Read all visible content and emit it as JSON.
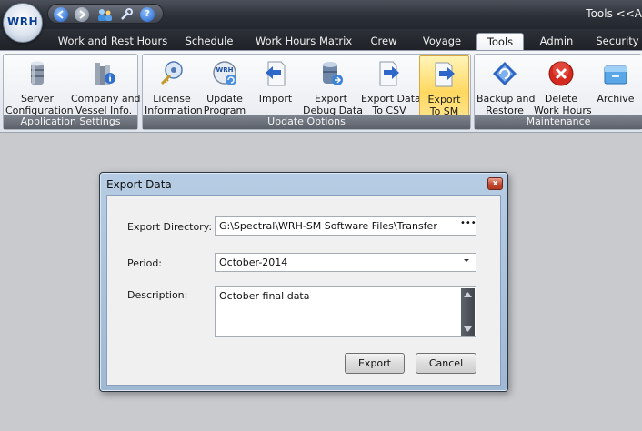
{
  "app": {
    "logo_text": "WRH",
    "window_title": "Tools <<A"
  },
  "quick_access": [
    "back-icon",
    "forward-icon",
    "users-icon",
    "tools-icon",
    "help-icon"
  ],
  "tabs": [
    {
      "label": "Work and Rest Hours"
    },
    {
      "label": "Schedule"
    },
    {
      "label": "Work Hours Matrix"
    },
    {
      "label": "Crew"
    },
    {
      "label": "Voyage"
    },
    {
      "label": "Tools"
    },
    {
      "label": "Admin"
    },
    {
      "label": "Security"
    }
  ],
  "active_tab": "Tools",
  "ribbon": {
    "groups": [
      {
        "label": "Application Settings",
        "buttons": [
          {
            "line1": "Server",
            "line2": "Configuration",
            "icon": "database-icon"
          },
          {
            "line1": "Company and",
            "line2": "Vessel Info.",
            "icon": "building-info-icon"
          }
        ]
      },
      {
        "label": "Update Options",
        "buttons": [
          {
            "line1": "License",
            "line2": "Information",
            "icon": "license-key-icon"
          },
          {
            "line1": "Update",
            "line2": "Program",
            "icon": "update-program-icon"
          },
          {
            "line1": "Import",
            "line2": "",
            "icon": "import-icon"
          },
          {
            "line1": "Export",
            "line2": "Debug Data",
            "icon": "export-debug-icon"
          },
          {
            "line1": "Export Data",
            "line2": "To CSV",
            "icon": "export-csv-icon"
          },
          {
            "line1": "Export",
            "line2": "To SM",
            "icon": "export-sm-icon"
          }
        ]
      },
      {
        "label": "Maintenance",
        "buttons": [
          {
            "line1": "Backup and",
            "line2": "Restore",
            "icon": "backup-restore-icon"
          },
          {
            "line1": "Delete",
            "line2": "Work Hours",
            "icon": "delete-icon"
          },
          {
            "line1": "Archive",
            "line2": "",
            "icon": "archive-icon"
          }
        ]
      }
    ]
  },
  "dialog": {
    "title": "Export Data",
    "close_glyph": "x",
    "export_directory_label": "Export Directory:",
    "export_directory_value": "G:\\Spectral\\WRH-SM Software Files\\Transfer",
    "browse_glyph": "•••",
    "period_label": "Period:",
    "period_value": "October-2014",
    "description_label": "Description:",
    "description_value": "October final data",
    "export_button": "Export",
    "cancel_button": "Cancel"
  },
  "colors": {
    "selected_button": "#ffd860",
    "title_bar": "#2c3038",
    "dialog_frame": "#a9c1db"
  }
}
